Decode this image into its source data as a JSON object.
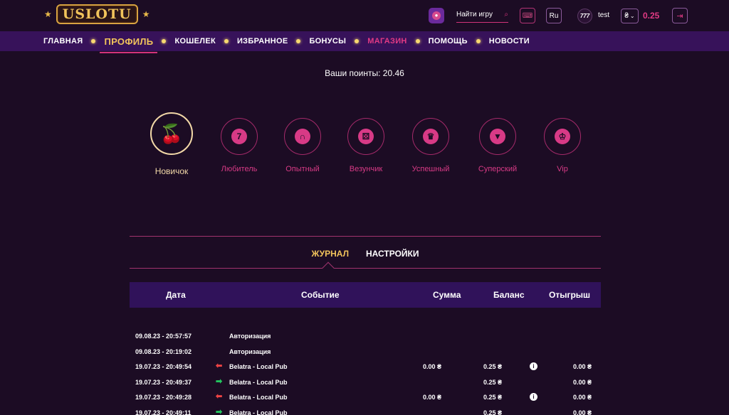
{
  "header": {
    "logo": "USLOTU",
    "search_placeholder": "Найти игру",
    "lang": "Ru",
    "avatar_text": "777",
    "username": "test",
    "currency_symbol": "₴",
    "balance": "0.25"
  },
  "nav": {
    "items": [
      {
        "label": "ГЛАВНАЯ"
      },
      {
        "label": "ПРОФИЛЬ"
      },
      {
        "label": "КОШЕЛЕК"
      },
      {
        "label": "ИЗБРАННОЕ"
      },
      {
        "label": "БОНУСЫ"
      },
      {
        "label": "МАГАЗИН"
      },
      {
        "label": "ПОМОЩЬ"
      },
      {
        "label": "НОВОСТИ"
      }
    ]
  },
  "points": "Ваши поинты: 20.46",
  "levels": [
    {
      "label": "Новичок",
      "icon": "cherry-icon"
    },
    {
      "label": "Любитель",
      "icon": "777-icon"
    },
    {
      "label": "Опытный",
      "icon": "horseshoe-icon"
    },
    {
      "label": "Везунчик",
      "icon": "dice-icon"
    },
    {
      "label": "Успешный",
      "icon": "trophy-icon"
    },
    {
      "label": "Суперский",
      "icon": "tuxedo-icon"
    },
    {
      "label": "Vip",
      "icon": "crown-icon"
    }
  ],
  "tabs": {
    "journal": "ЖУРНАЛ",
    "settings": "НАСТРОЙКИ"
  },
  "table": {
    "headers": {
      "date": "Дата",
      "event": "Событие",
      "sum": "Сумма",
      "balance": "Баланс",
      "winnings": "Отыгрыш"
    },
    "rows": [
      {
        "date": "09.08.23 - 20:57:57",
        "arrow": "",
        "event": "Авторизация",
        "sum": "",
        "balance": "",
        "info": "",
        "win": ""
      },
      {
        "date": "09.08.23 - 20:19:02",
        "arrow": "",
        "event": "Авторизация",
        "sum": "",
        "balance": "",
        "info": "",
        "win": ""
      },
      {
        "date": "19.07.23 - 20:49:54",
        "arrow": "out",
        "event": "Belatra - Local Pub",
        "sum": "0.00 ₴",
        "balance": "0.25 ₴",
        "info": "i",
        "win": "0.00 ₴"
      },
      {
        "date": "19.07.23 - 20:49:37",
        "arrow": "in",
        "event": "Belatra - Local Pub",
        "sum": "",
        "balance": "0.25 ₴",
        "info": "",
        "win": "0.00 ₴"
      },
      {
        "date": "19.07.23 - 20:49:28",
        "arrow": "out",
        "event": "Belatra - Local Pub",
        "sum": "0.00 ₴",
        "balance": "0.25 ₴",
        "info": "i",
        "win": "0.00 ₴"
      },
      {
        "date": "19.07.23 - 20:49:11",
        "arrow": "in",
        "event": "Belatra - Local Pub",
        "sum": "",
        "balance": "0.25 ₴",
        "info": "",
        "win": "0.00 ₴"
      }
    ]
  },
  "colors": {
    "background": "#1c0c24",
    "nav": "#37125a",
    "accent_pink": "#d83a86",
    "accent_gold": "#f1c35b"
  }
}
